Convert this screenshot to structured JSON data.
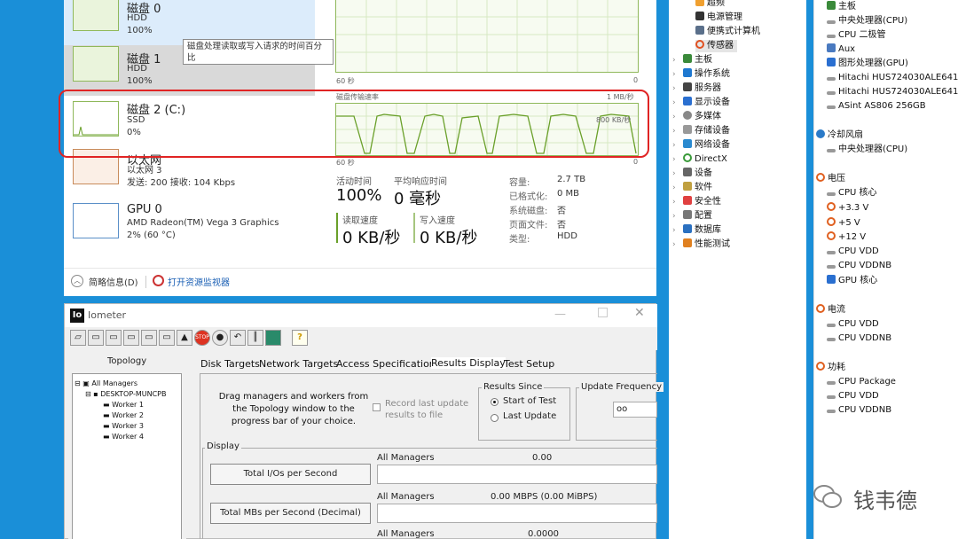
{
  "task_manager": {
    "disks": [
      {
        "name": "磁盘 0",
        "type": "HDD",
        "usage": "100%"
      },
      {
        "name": "磁盘 1",
        "type": "HDD",
        "usage": "100%"
      },
      {
        "name": "磁盘 2 (C:)",
        "type": "SSD",
        "usage": "0%"
      }
    ],
    "ethernet": {
      "name": "以太网",
      "sub": "以太网 3",
      "stats": "发送: 200 接收: 104 Kbps"
    },
    "gpu": {
      "name": "GPU 0",
      "model": "AMD Radeon(TM) Vega 3 Graphics",
      "stats": "2% (60 °C)"
    },
    "tooltip": "磁盘处理读取或写入请求的时间百分比",
    "graph_top": {
      "left_label": "60 秒",
      "right_label": "0"
    },
    "graph_transfer": {
      "title": "磁盘传输速率",
      "max": "1 MB/秒",
      "mid": "800 KB/秒",
      "left_label": "60 秒",
      "right_label": "0"
    },
    "stats": {
      "active_time_label": "活动时间",
      "active_time": "100%",
      "avg_response_label": "平均响应时间",
      "avg_response": "0 毫秒",
      "read_label": "读取速度",
      "read": "0 KB/秒",
      "write_label": "写入速度",
      "write": "0 KB/秒",
      "capacity_label": "容量:",
      "capacity": "2.7 TB",
      "formatted_label": "已格式化:",
      "formatted": "0 MB",
      "system_disk_label": "系统磁盘:",
      "system_disk": "否",
      "page_file_label": "页面文件:",
      "page_file": "否",
      "type_label": "类型:",
      "type": "HDD"
    },
    "footer": {
      "summary": "简略信息(D)",
      "resmon": "打开资源监视器"
    }
  },
  "device_tree": {
    "top_items": [
      "超频",
      "电源管理",
      "便携式计算机",
      "传感器"
    ],
    "items": [
      "主板",
      "操作系统",
      "服务器",
      "显示设备",
      "多媒体",
      "存储设备",
      "网络设备",
      "DirectX",
      "设备",
      "软件",
      "安全性",
      "配置",
      "数据库",
      "性能测试"
    ]
  },
  "sensors": {
    "temp_items": [
      "主板",
      "中央处理器(CPU)",
      "CPU 二极管",
      "Aux",
      "图形处理器(GPU)",
      "Hitachi HUS724030ALE641 (P8",
      "Hitachi HUS724030ALE641 (P8",
      "ASint AS806 256GB"
    ],
    "fan_header": "冷却风扇",
    "fan_items": [
      "中央处理器(CPU)"
    ],
    "voltage_header": "电压",
    "voltage_items": [
      "CPU 核心",
      "+3.3 V",
      "+5 V",
      "+12 V",
      "CPU VDD",
      "CPU VDDNB",
      "GPU 核心"
    ],
    "current_header": "电流",
    "current_items": [
      "CPU VDD",
      "CPU VDDNB"
    ],
    "power_header": "功耗",
    "power_items": [
      "CPU Package",
      "CPU VDD",
      "CPU VDDNB"
    ]
  },
  "iometer": {
    "logo": "Io",
    "title": "Iometer",
    "topology_label": "Topology",
    "tree": [
      "All Managers",
      "DESKTOP-MUNCPB",
      "Worker 1",
      "Worker 2",
      "Worker 3",
      "Worker 4"
    ],
    "tabs": [
      "Disk Targets",
      "Network Targets",
      "Access Specifications",
      "Results Display",
      "Test Setup"
    ],
    "drag_text": "Drag managers and workers from the Topology window to the progress bar of your choice.",
    "record_label": "Record last update results to file",
    "results_since_label": "Results Since",
    "start_of_test": "Start of Test",
    "last_update": "Last Update",
    "update_freq_label": "Update Frequency",
    "update_freq_value": "oo",
    "display_label": "Display",
    "rows": [
      {
        "button": "Total I/Os per Second",
        "manager": "All Managers",
        "value": "0.00"
      },
      {
        "button": "Total MBs per Second (Decimal)",
        "manager": "All Managers",
        "value": "0.00 MBPS (0.00 MiBPS)"
      },
      {
        "button": "",
        "manager": "All Managers",
        "value": "0.0000"
      }
    ]
  },
  "watermark": "钱韦德"
}
